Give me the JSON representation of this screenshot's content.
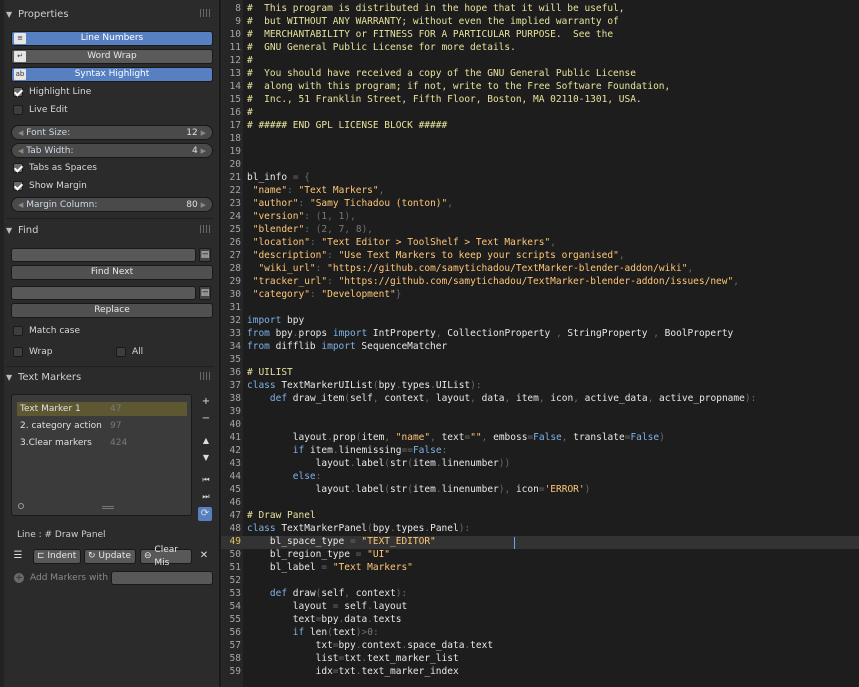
{
  "properties": {
    "title": "Properties",
    "line_numbers": "Line Numbers",
    "word_wrap": "Word Wrap",
    "syntax_highlight": "Syntax Highlight",
    "highlight_line": "Highlight Line",
    "live_edit": "Live Edit",
    "font_size_label": "Font Size:",
    "font_size": "12",
    "tab_width_label": "Tab Width:",
    "tab_width": "4",
    "tabs_as_spaces": "Tabs as Spaces",
    "show_margin": "Show Margin",
    "margin_column_label": "Margin Column:",
    "margin_column": "80"
  },
  "find": {
    "title": "Find",
    "find_next": "Find Next",
    "replace": "Replace",
    "match_case": "Match case",
    "wrap": "Wrap",
    "all": "All"
  },
  "markers": {
    "title": "Text Markers",
    "items": [
      {
        "name": "Text Marker 1",
        "line": "47"
      },
      {
        "name": "2. category action",
        "line": "97"
      },
      {
        "name": "3.Clear markers",
        "line": "424"
      }
    ],
    "line_info": "Line : # Draw Panel",
    "indent": "Indent",
    "update": "Update",
    "clear": "Clear Mis",
    "add_markers": "Add Markers with"
  },
  "editor": {
    "current_line": "49",
    "lines": [
      {
        "n": "8",
        "t": "#  This program is distributed in the hope that it will be useful,"
      },
      {
        "n": "9",
        "t": "#  but WITHOUT ANY WARRANTY; without even the implied warranty of"
      },
      {
        "n": "10",
        "t": "#  MERCHANTABILITY or FITNESS FOR A PARTICULAR PURPOSE.  See the"
      },
      {
        "n": "11",
        "t": "#  GNU General Public License for more details."
      },
      {
        "n": "12",
        "t": "#"
      },
      {
        "n": "13",
        "t": "#  You should have received a copy of the GNU General Public License"
      },
      {
        "n": "14",
        "t": "#  along with this program; if not, write to the Free Software Foundation,"
      },
      {
        "n": "15",
        "t": "#  Inc., 51 Franklin Street, Fifth Floor, Boston, MA 02110-1301, USA."
      },
      {
        "n": "16",
        "t": "#"
      },
      {
        "n": "17",
        "t": "# ##### END GPL LICENSE BLOCK #####"
      },
      {
        "n": "18",
        "t": ""
      },
      {
        "n": "19",
        "t": ""
      },
      {
        "n": "20",
        "t": ""
      },
      {
        "n": "21",
        "t": "bl_info = {"
      },
      {
        "n": "22",
        "t": " \"name\": \"Text Markers\","
      },
      {
        "n": "23",
        "t": " \"author\": \"Samy Tichadou (tonton)\","
      },
      {
        "n": "24",
        "t": " \"version\": (1, 1),"
      },
      {
        "n": "25",
        "t": " \"blender\": (2, 7, 8),"
      },
      {
        "n": "26",
        "t": " \"location\": \"Text Editor > ToolShelf > Text Markers\","
      },
      {
        "n": "27",
        "t": " \"description\": \"Use Text Markers to keep your scripts organised\","
      },
      {
        "n": "28",
        "t": "  \"wiki_url\": \"https://github.com/samytichadou/TextMarker-blender-addon/wiki\","
      },
      {
        "n": "29",
        "t": " \"tracker_url\": \"https://github.com/samytichadou/TextMarker-blender-addon/issues/new\","
      },
      {
        "n": "30",
        "t": " \"category\": \"Development\"}"
      },
      {
        "n": "31",
        "t": ""
      },
      {
        "n": "32",
        "t": "import bpy"
      },
      {
        "n": "33",
        "t": "from bpy.props import IntProperty, CollectionProperty , StringProperty , BoolProperty"
      },
      {
        "n": "34",
        "t": "from difflib import SequenceMatcher"
      },
      {
        "n": "35",
        "t": ""
      },
      {
        "n": "36",
        "t": "# UILIST"
      },
      {
        "n": "37",
        "t": "class TextMarkerUIList(bpy.types.UIList):"
      },
      {
        "n": "38",
        "t": "    def draw_item(self, context, layout, data, item, icon, active_data, active_propname):"
      },
      {
        "n": "39",
        "t": ""
      },
      {
        "n": "40",
        "t": ""
      },
      {
        "n": "41",
        "t": "        layout.prop(item, \"name\", text=\"\", emboss=False, translate=False)"
      },
      {
        "n": "42",
        "t": "        if item.linemissing==False:"
      },
      {
        "n": "43",
        "t": "            layout.label(str(item.linenumber))"
      },
      {
        "n": "44",
        "t": "        else:"
      },
      {
        "n": "45",
        "t": "            layout.label(str(item.linenumber), icon='ERROR')"
      },
      {
        "n": "46",
        "t": ""
      },
      {
        "n": "47",
        "t": "# Draw Panel"
      },
      {
        "n": "48",
        "t": "class TextMarkerPanel(bpy.types.Panel):"
      },
      {
        "n": "49",
        "t": "    bl_space_type = \"TEXT_EDITOR\""
      },
      {
        "n": "50",
        "t": "    bl_region_type = \"UI\""
      },
      {
        "n": "51",
        "t": "    bl_label = \"Text Markers\""
      },
      {
        "n": "52",
        "t": ""
      },
      {
        "n": "53",
        "t": "    def draw(self, context):"
      },
      {
        "n": "54",
        "t": "        layout = self.layout"
      },
      {
        "n": "55",
        "t": "        text=bpy.data.texts"
      },
      {
        "n": "56",
        "t": "        if len(text)>0:"
      },
      {
        "n": "57",
        "t": "            txt=bpy.context.space_data.text"
      },
      {
        "n": "58",
        "t": "            list=txt.text_marker_list"
      },
      {
        "n": "59",
        "t": "            idx=txt.text_marker_index"
      }
    ]
  }
}
